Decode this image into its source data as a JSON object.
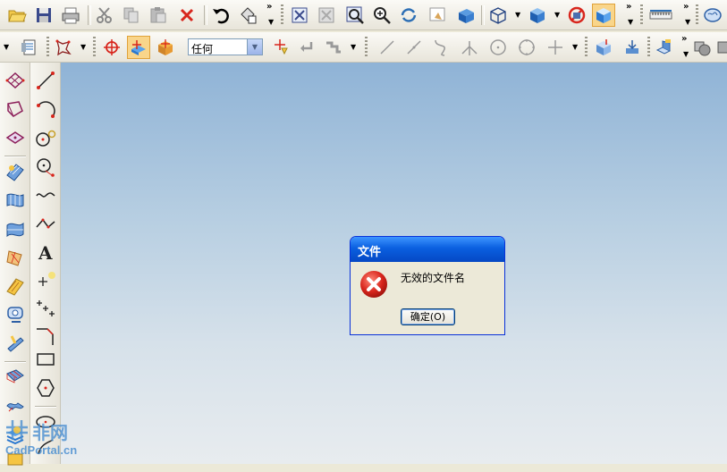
{
  "toolbar_top": {
    "icons": [
      "open-folder-icon",
      "save-icon",
      "print-icon",
      "cut-icon",
      "copy-icon",
      "paste-icon",
      "delete-icon",
      "undo-icon",
      "paint-icon",
      "fit-view-icon",
      "zoom-window-icon",
      "zoom-box-icon",
      "zoom-in-icon",
      "rotate-icon",
      "pan-icon",
      "box-icon",
      "wireframe-cube-icon",
      "shaded-cube-icon",
      "hidden-icon",
      "shaded-view-icon",
      "measure-icon",
      "brain-icon"
    ],
    "overflow": "»"
  },
  "toolbar_second": {
    "combo_value": "任何",
    "overflow": "»"
  },
  "dialog": {
    "title": "文件",
    "message": "无效的文件名",
    "ok_label": "确定(O)"
  },
  "watermark": {
    "text": "CadPortal.cn",
    "logo_text": "非网"
  },
  "colors": {
    "dialog_title_bg": "#0a5fe0",
    "error_red": "#d8261d",
    "canvas_top": "#8fb3d6",
    "canvas_bottom": "#e8ecef"
  }
}
